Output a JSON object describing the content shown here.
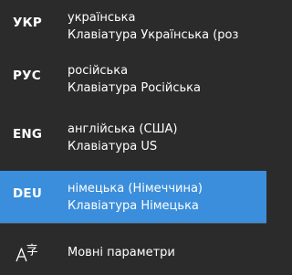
{
  "languages": [
    {
      "code": "УКР",
      "name": "українська",
      "keyboard": "Клавіатура Українська (роз"
    },
    {
      "code": "РУС",
      "name": "російська",
      "keyboard": "Клавіатура Російська"
    },
    {
      "code": "ENG",
      "name": "англійська (США)",
      "keyboard": "Клавіатура US"
    },
    {
      "code": "DEU",
      "name": "німецька (Німеччина)",
      "keyboard": "Клавіатура Німецька"
    }
  ],
  "selected_index": 3,
  "footer": {
    "settings_label": "Мовні параметри",
    "settings_icon": "language-settings-icon"
  },
  "colors": {
    "background": "#2b2b2b",
    "selected": "#3b8edb",
    "text": "#ffffff"
  }
}
